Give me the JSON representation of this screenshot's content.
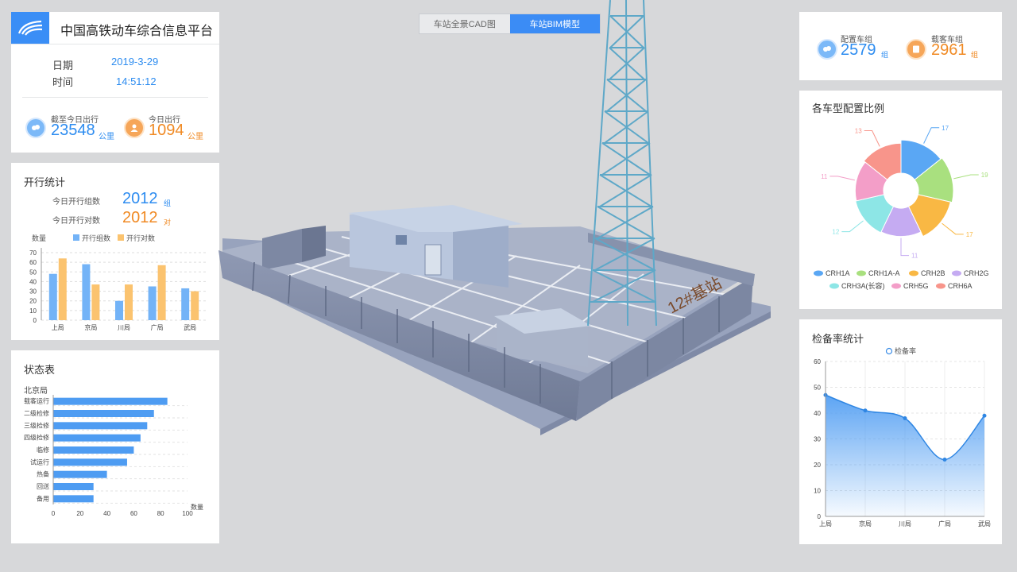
{
  "app": {
    "title": "中国高铁动车综合信息平台"
  },
  "datetime": {
    "date_label": "日期",
    "date_value": "2019-3-29",
    "time_label": "时间",
    "time_value": "14:51:12"
  },
  "mileage": {
    "total": {
      "label": "截至今日出行",
      "value": "23548",
      "unit": "公里"
    },
    "today": {
      "label": "今日出行",
      "value": "1094",
      "unit": "公里"
    }
  },
  "tabs": [
    {
      "label": "车站全景CAD图",
      "active": false
    },
    {
      "label": "车站BIM模型",
      "active": true
    }
  ],
  "model_sign": "12#基站",
  "fleet": {
    "configured": {
      "label": "配置车组",
      "value": "2579",
      "unit": "组"
    },
    "carrying": {
      "label": "载客车组",
      "value": "2961",
      "unit": "组"
    }
  },
  "operation": {
    "title": "开行统计",
    "groups": {
      "label": "今日开行组数",
      "value": "2012",
      "unit": "组"
    },
    "pairs": {
      "label": "今日开行对数",
      "value": "2012",
      "unit": "对"
    }
  },
  "status": {
    "title": "状态表",
    "subtitle": "北京局"
  },
  "ratio": {
    "title": "各车型配置比例"
  },
  "spare": {
    "title": "检备率统计"
  },
  "colors": {
    "blue": "#2d8cf0",
    "orange": "#f08a24",
    "bar_blue": "#73b3f7",
    "bar_orange": "#fbc36f"
  },
  "chart_data": [
    {
      "id": "operation-bar",
      "type": "bar",
      "ylabel": "数量",
      "categories": [
        "上局",
        "京局",
        "川局",
        "广局",
        "武局"
      ],
      "series": [
        {
          "name": "开行组数",
          "color": "#73b3f7",
          "values": [
            48,
            58,
            20,
            35,
            33
          ]
        },
        {
          "name": "开行对数",
          "color": "#fbc36f",
          "values": [
            64,
            37,
            37,
            57,
            30
          ]
        }
      ],
      "ylim": [
        0,
        70
      ],
      "yticks": [
        0,
        10,
        20,
        30,
        40,
        50,
        60,
        70
      ],
      "legend": "top"
    },
    {
      "id": "status-bar",
      "type": "bar",
      "orientation": "horizontal",
      "xlabel": "数量",
      "categories": [
        "载客运行",
        "二级检修",
        "三级检修",
        "四级检修",
        "临修",
        "试运行",
        "热备",
        "回送",
        "备用"
      ],
      "values": [
        85,
        75,
        70,
        65,
        60,
        55,
        40,
        30,
        30
      ],
      "xlim": [
        0,
        100
      ],
      "xticks": [
        0,
        20,
        40,
        60,
        80,
        100
      ]
    },
    {
      "id": "ratio-pie",
      "type": "pie",
      "style": "rose-donut",
      "slices": [
        {
          "name": "CRH1A",
          "value": 17,
          "color": "#5aa7f4"
        },
        {
          "name": "CRH1A-A",
          "value": 19,
          "color": "#a9e07f"
        },
        {
          "name": "CRH2B",
          "value": 17,
          "color": "#f9b844"
        },
        {
          "name": "CRH2G",
          "value": 11,
          "color": "#c5abf2"
        },
        {
          "name": "CRH3A(长容)",
          "value": 12,
          "color": "#8de6e6"
        },
        {
          "name": "CRH5G",
          "value": 11,
          "color": "#f39ec8"
        },
        {
          "name": "CRH6A",
          "value": 13,
          "color": "#f8958b"
        }
      ],
      "legend": "bottom"
    },
    {
      "id": "spare-line",
      "type": "area",
      "series": [
        {
          "name": "检备率",
          "values": [
            47,
            41,
            38,
            22,
            39
          ]
        }
      ],
      "categories": [
        "上局",
        "京局",
        "川局",
        "广局",
        "武局"
      ],
      "ylim": [
        0,
        60
      ],
      "yticks": [
        0,
        10,
        20,
        30,
        40,
        50,
        60
      ],
      "legend": "top"
    }
  ]
}
